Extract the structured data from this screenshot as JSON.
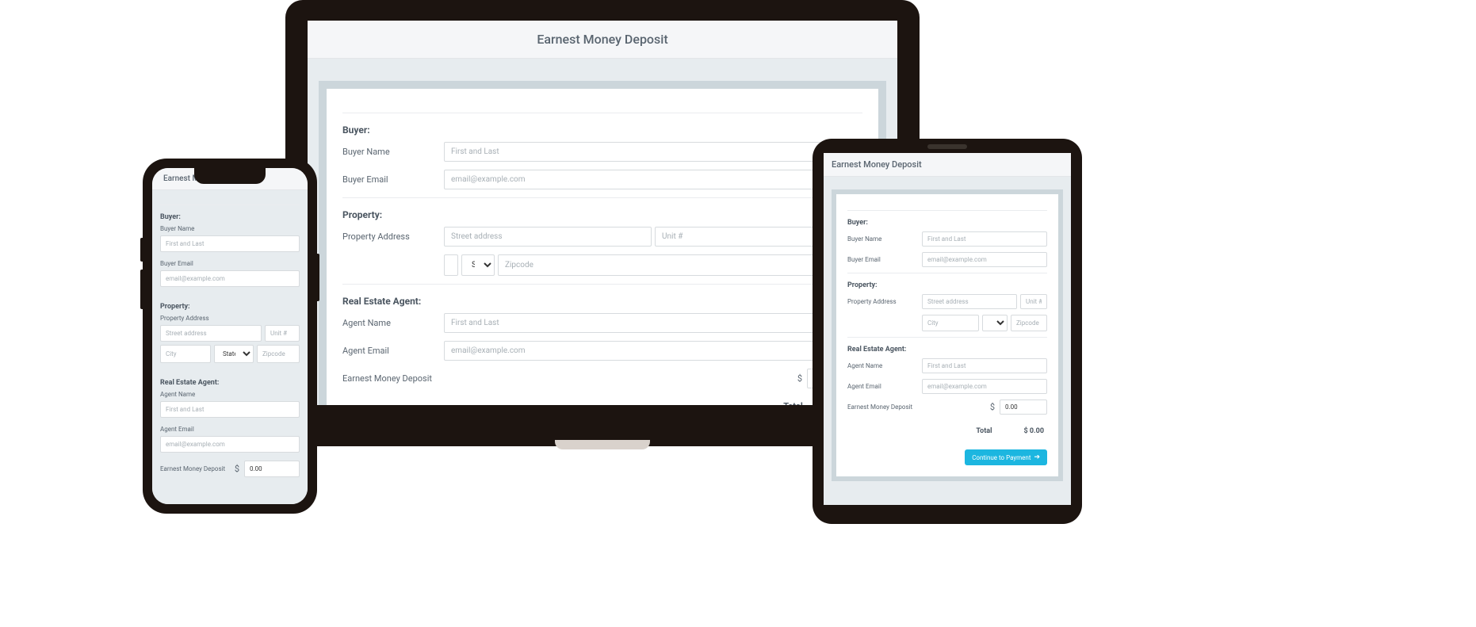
{
  "header": {
    "title": "Earnest Money Deposit"
  },
  "sections": {
    "buyer": {
      "title": "Buyer:",
      "name_label": "Buyer Name",
      "name_placeholder": "First and Last",
      "email_label": "Buyer Email",
      "email_placeholder": "email@example.com"
    },
    "property": {
      "title": "Property:",
      "address_label": "Property Address",
      "street_placeholder": "Street address",
      "unit_placeholder": "Unit #",
      "city_placeholder": "City",
      "state_placeholder_full": "State",
      "state_placeholder_short": "Sta",
      "state_placeholder_tiny": "St",
      "zip_placeholder": "Zipcode"
    },
    "agent": {
      "title": "Real Estate Agent:",
      "name_label": "Agent Name",
      "name_placeholder": "First and Last",
      "email_label": "Agent Email",
      "email_placeholder": "email@example.com"
    },
    "deposit": {
      "label": "Earnest Money Deposit",
      "currency": "$",
      "value": "0.00"
    }
  },
  "total": {
    "label": "Total",
    "value": "$ 0.00"
  },
  "actions": {
    "continue": "Continue to Payment"
  }
}
